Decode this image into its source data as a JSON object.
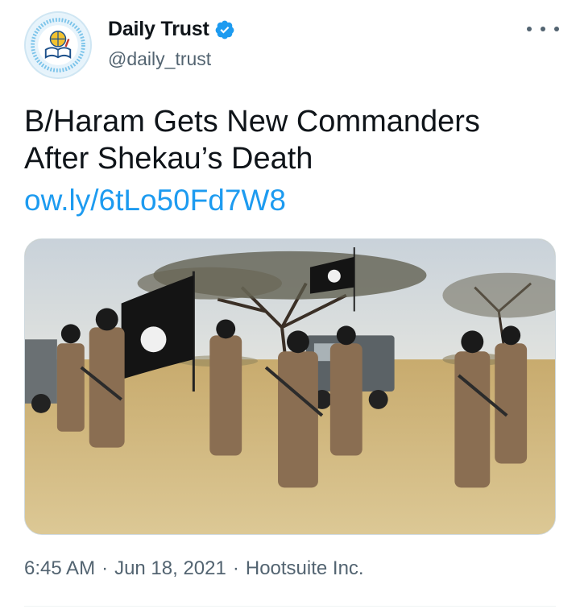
{
  "author": {
    "display_name": "Daily Trust",
    "handle": "@daily_trust",
    "verified": true,
    "avatar_icon": "daily-trust-logo-icon",
    "more_icon": "more-dots-icon"
  },
  "tweet": {
    "text_lines": [
      "B/Haram Gets New Commanders",
      "After Shekau’s Death"
    ],
    "link": "ow.ly/6tLo50Fd7W8",
    "image_icon": "news-photo",
    "time": "6:45 AM",
    "date": "Jun 18, 2021",
    "separator": "·",
    "source": "Hootsuite Inc."
  },
  "colors": {
    "link": "#1d9bf0",
    "text": "#0f1419",
    "secondary": "#536471",
    "verified_badge": "#1d9bf0"
  }
}
